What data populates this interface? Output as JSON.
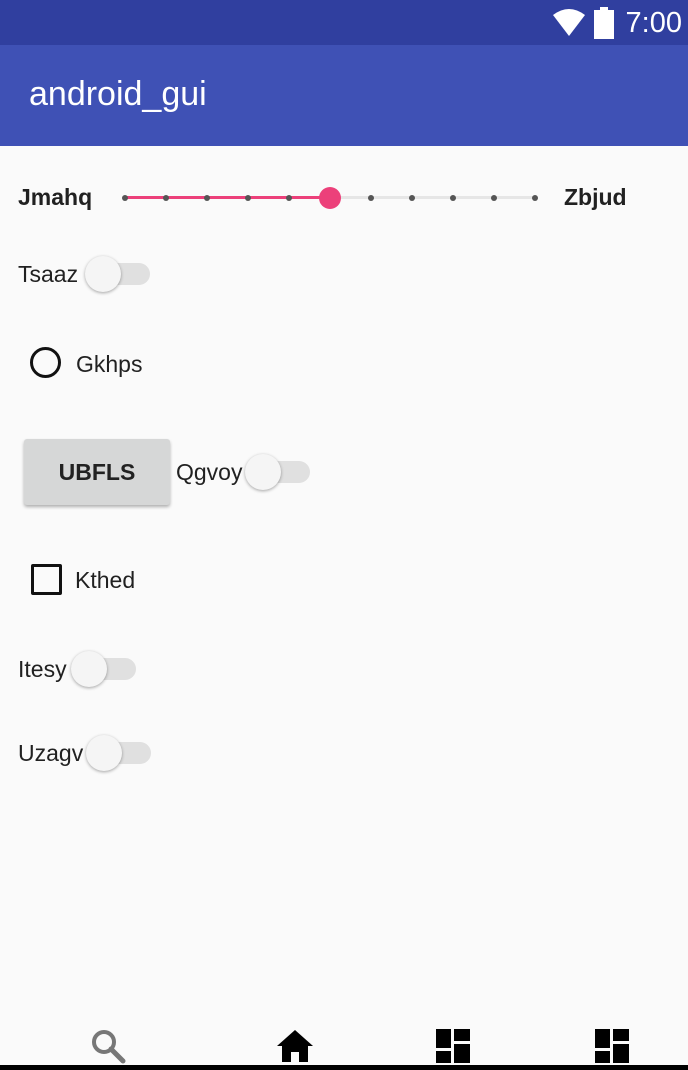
{
  "status_bar": {
    "time": "7:00"
  },
  "app_bar": {
    "title": "android_gui"
  },
  "seekbar": {
    "left_label": "Jmahq",
    "right_label": "Zbjud",
    "steps": 10,
    "value": 5,
    "accent": "#ec407a"
  },
  "switches": [
    {
      "label": "Tsaaz",
      "checked": false
    },
    {
      "label": "Qgvoy",
      "checked": false
    },
    {
      "label": "Itesy",
      "checked": false
    },
    {
      "label": "Uzagv",
      "checked": false
    }
  ],
  "radio": {
    "label": "Gkhps",
    "checked": false
  },
  "button": {
    "label": "UBFLS"
  },
  "checkbox": {
    "label": "Kthed",
    "checked": false
  },
  "bottom_nav": [
    {
      "icon": "search-icon"
    },
    {
      "icon": "home-icon"
    },
    {
      "icon": "dashboard-icon"
    },
    {
      "icon": "dashboard-icon"
    }
  ],
  "colors": {
    "status_bar": "#303f9f",
    "app_bar": "#3f51b5",
    "accent": "#ec407a"
  }
}
